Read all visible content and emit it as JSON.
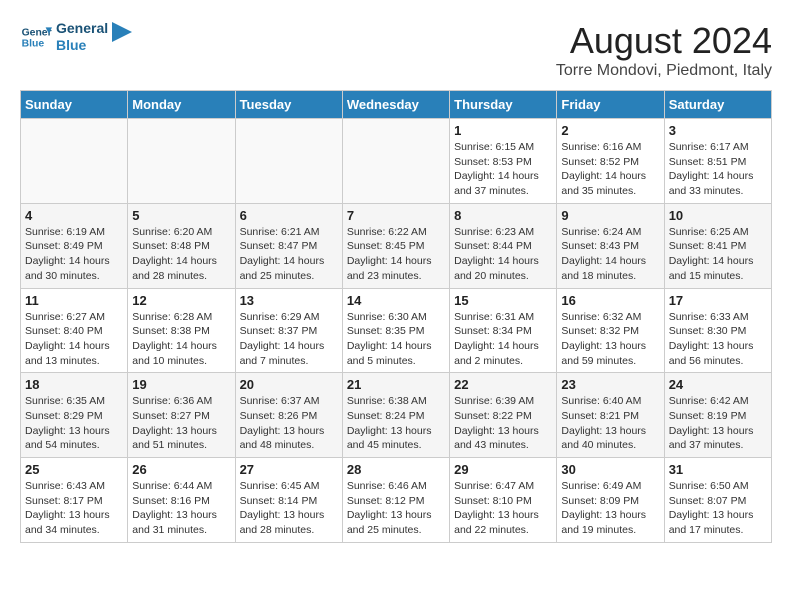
{
  "logo": {
    "line1": "General",
    "line2": "Blue"
  },
  "title": "August 2024",
  "subtitle": "Torre Mondovi, Piedmont, Italy",
  "headers": [
    "Sunday",
    "Monday",
    "Tuesday",
    "Wednesday",
    "Thursday",
    "Friday",
    "Saturday"
  ],
  "weeks": [
    [
      {
        "day": "",
        "info": ""
      },
      {
        "day": "",
        "info": ""
      },
      {
        "day": "",
        "info": ""
      },
      {
        "day": "",
        "info": ""
      },
      {
        "day": "1",
        "info": "Sunrise: 6:15 AM\nSunset: 8:53 PM\nDaylight: 14 hours and 37 minutes."
      },
      {
        "day": "2",
        "info": "Sunrise: 6:16 AM\nSunset: 8:52 PM\nDaylight: 14 hours and 35 minutes."
      },
      {
        "day": "3",
        "info": "Sunrise: 6:17 AM\nSunset: 8:51 PM\nDaylight: 14 hours and 33 minutes."
      }
    ],
    [
      {
        "day": "4",
        "info": "Sunrise: 6:19 AM\nSunset: 8:49 PM\nDaylight: 14 hours and 30 minutes."
      },
      {
        "day": "5",
        "info": "Sunrise: 6:20 AM\nSunset: 8:48 PM\nDaylight: 14 hours and 28 minutes."
      },
      {
        "day": "6",
        "info": "Sunrise: 6:21 AM\nSunset: 8:47 PM\nDaylight: 14 hours and 25 minutes."
      },
      {
        "day": "7",
        "info": "Sunrise: 6:22 AM\nSunset: 8:45 PM\nDaylight: 14 hours and 23 minutes."
      },
      {
        "day": "8",
        "info": "Sunrise: 6:23 AM\nSunset: 8:44 PM\nDaylight: 14 hours and 20 minutes."
      },
      {
        "day": "9",
        "info": "Sunrise: 6:24 AM\nSunset: 8:43 PM\nDaylight: 14 hours and 18 minutes."
      },
      {
        "day": "10",
        "info": "Sunrise: 6:25 AM\nSunset: 8:41 PM\nDaylight: 14 hours and 15 minutes."
      }
    ],
    [
      {
        "day": "11",
        "info": "Sunrise: 6:27 AM\nSunset: 8:40 PM\nDaylight: 14 hours and 13 minutes."
      },
      {
        "day": "12",
        "info": "Sunrise: 6:28 AM\nSunset: 8:38 PM\nDaylight: 14 hours and 10 minutes."
      },
      {
        "day": "13",
        "info": "Sunrise: 6:29 AM\nSunset: 8:37 PM\nDaylight: 14 hours and 7 minutes."
      },
      {
        "day": "14",
        "info": "Sunrise: 6:30 AM\nSunset: 8:35 PM\nDaylight: 14 hours and 5 minutes."
      },
      {
        "day": "15",
        "info": "Sunrise: 6:31 AM\nSunset: 8:34 PM\nDaylight: 14 hours and 2 minutes."
      },
      {
        "day": "16",
        "info": "Sunrise: 6:32 AM\nSunset: 8:32 PM\nDaylight: 13 hours and 59 minutes."
      },
      {
        "day": "17",
        "info": "Sunrise: 6:33 AM\nSunset: 8:30 PM\nDaylight: 13 hours and 56 minutes."
      }
    ],
    [
      {
        "day": "18",
        "info": "Sunrise: 6:35 AM\nSunset: 8:29 PM\nDaylight: 13 hours and 54 minutes."
      },
      {
        "day": "19",
        "info": "Sunrise: 6:36 AM\nSunset: 8:27 PM\nDaylight: 13 hours and 51 minutes."
      },
      {
        "day": "20",
        "info": "Sunrise: 6:37 AM\nSunset: 8:26 PM\nDaylight: 13 hours and 48 minutes."
      },
      {
        "day": "21",
        "info": "Sunrise: 6:38 AM\nSunset: 8:24 PM\nDaylight: 13 hours and 45 minutes."
      },
      {
        "day": "22",
        "info": "Sunrise: 6:39 AM\nSunset: 8:22 PM\nDaylight: 13 hours and 43 minutes."
      },
      {
        "day": "23",
        "info": "Sunrise: 6:40 AM\nSunset: 8:21 PM\nDaylight: 13 hours and 40 minutes."
      },
      {
        "day": "24",
        "info": "Sunrise: 6:42 AM\nSunset: 8:19 PM\nDaylight: 13 hours and 37 minutes."
      }
    ],
    [
      {
        "day": "25",
        "info": "Sunrise: 6:43 AM\nSunset: 8:17 PM\nDaylight: 13 hours and 34 minutes."
      },
      {
        "day": "26",
        "info": "Sunrise: 6:44 AM\nSunset: 8:16 PM\nDaylight: 13 hours and 31 minutes."
      },
      {
        "day": "27",
        "info": "Sunrise: 6:45 AM\nSunset: 8:14 PM\nDaylight: 13 hours and 28 minutes."
      },
      {
        "day": "28",
        "info": "Sunrise: 6:46 AM\nSunset: 8:12 PM\nDaylight: 13 hours and 25 minutes."
      },
      {
        "day": "29",
        "info": "Sunrise: 6:47 AM\nSunset: 8:10 PM\nDaylight: 13 hours and 22 minutes."
      },
      {
        "day": "30",
        "info": "Sunrise: 6:49 AM\nSunset: 8:09 PM\nDaylight: 13 hours and 19 minutes."
      },
      {
        "day": "31",
        "info": "Sunrise: 6:50 AM\nSunset: 8:07 PM\nDaylight: 13 hours and 17 minutes."
      }
    ]
  ]
}
